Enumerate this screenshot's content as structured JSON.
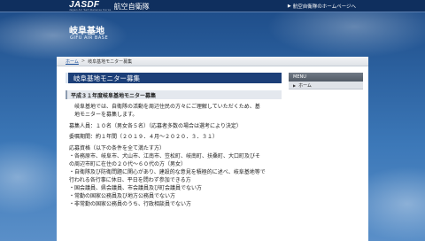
{
  "header": {
    "logo_text": "JASDF",
    "logo_subtext": "Japan Air Self-Defense Force",
    "org_name": "航空自衛隊",
    "top_link": "航空自衛隊のホームページへ"
  },
  "base": {
    "title": "岐阜基地",
    "subtitle": "GIFU AIR BASE"
  },
  "breadcrumb": {
    "home": "ホーム",
    "separator": ">",
    "current": "岐阜基地モニター募集"
  },
  "main": {
    "heading": "岐阜基地モニター募集",
    "subheading": "平成３１年度岐阜基地モニター募集",
    "intro_lines": [
      "岐阜基地では、自衛隊の活動を周辺住民の方々にご理解していただくため、基",
      "地モニターを募集します。"
    ],
    "recruit_count": "募集人員：１０名（男女各５名）（応募者多数の場合は選考により決定）",
    "term": "委嘱期間：約１年間（２０１９．４月～２０２０．３．３１）",
    "qualification_lines": [
      "応募資格（以下の条件を全て満たす方）",
      "・各務原市、岐阜市、犬山市、江南市、笠松町、岐南町、扶桑町、大口町及びそ",
      "の周辺市町に在住の２０代～６０代の方（男女）",
      "・自衛隊及び防衛問題に関心があり、建設的な意見を積極的に述べ、岐阜基地等で",
      "行われる各行事に休日、平日を問わず参加できる方",
      "・国会議員、県会議員、市会議員及び町会議員でない方",
      "・常勤の国家公務員及び地方公務員でない方",
      "・非常勤の国家公務員のうち、行政相談員でない方"
    ]
  },
  "side": {
    "menu_heading": "MENU",
    "items": [
      "ホーム"
    ]
  }
}
